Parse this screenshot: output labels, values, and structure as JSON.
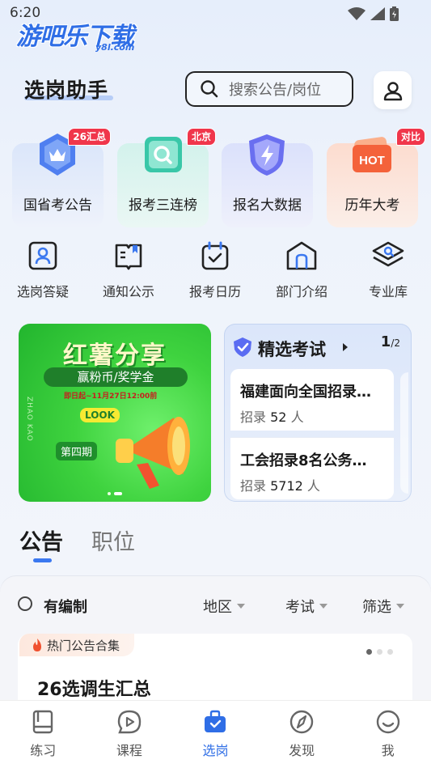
{
  "status": {
    "time": "6:20"
  },
  "watermark": {
    "brand": "游吧乐下载",
    "sub": "y8l.com"
  },
  "header": {
    "title": "选岗助手",
    "search_placeholder": "搜索公告/岗位"
  },
  "tiles": [
    {
      "label": "国省考公告",
      "badge": "26汇总",
      "icon": "crown-shield-icon"
    },
    {
      "label": "报考三连榜",
      "badge": "北京",
      "icon": "magnifier-card-icon"
    },
    {
      "label": "报名大数据",
      "badge": "",
      "icon": "lightning-shield-icon"
    },
    {
      "label": "历年大考",
      "badge": "对比",
      "icon": "hot-folder-icon",
      "icon_text": "HOT"
    }
  ],
  "shortcuts": [
    {
      "label": "选岗答疑",
      "icon": "person-card-icon"
    },
    {
      "label": "通知公示",
      "icon": "notice-book-icon"
    },
    {
      "label": "报考日历",
      "icon": "calendar-check-icon"
    },
    {
      "label": "部门介绍",
      "icon": "building-icon"
    },
    {
      "label": "专业库",
      "icon": "layers-search-icon"
    }
  ],
  "promo": {
    "title": "红薯分享",
    "subtitle": "赢粉币/奖学金",
    "date": "即日起~11月27日12:00前",
    "look": "LOOK",
    "episode": "第四期",
    "side_text": "ZHAO KAO"
  },
  "exam": {
    "title": "精选考试",
    "page_current": "1",
    "page_total": "/2",
    "items": [
      {
        "title": "福建面向全国招录…",
        "recruit_label": "招录",
        "count": "52",
        "unit": "人"
      },
      {
        "title": "工会招录8名公务…",
        "recruit_label": "招录",
        "count": "5712",
        "unit": "人"
      }
    ]
  },
  "tabs": {
    "active": "公告",
    "inactive": "职位"
  },
  "filters": {
    "toggle_label": "有编制",
    "region": "地区",
    "exam": "考试",
    "filter": "筛选"
  },
  "hot": {
    "tag": "热门公告合集",
    "title": "26选调生汇总"
  },
  "nav": [
    {
      "label": "练习",
      "icon": "book-icon",
      "active": false
    },
    {
      "label": "课程",
      "icon": "play-bubble-icon",
      "active": false
    },
    {
      "label": "选岗",
      "icon": "briefcase-icon",
      "active": true
    },
    {
      "label": "发现",
      "icon": "compass-icon",
      "active": false
    },
    {
      "label": "我",
      "icon": "smile-face-icon",
      "active": false
    }
  ],
  "colors": {
    "accent": "#2f6ee6",
    "badge": "#f0364b",
    "promo_green": "#3fd33f"
  }
}
